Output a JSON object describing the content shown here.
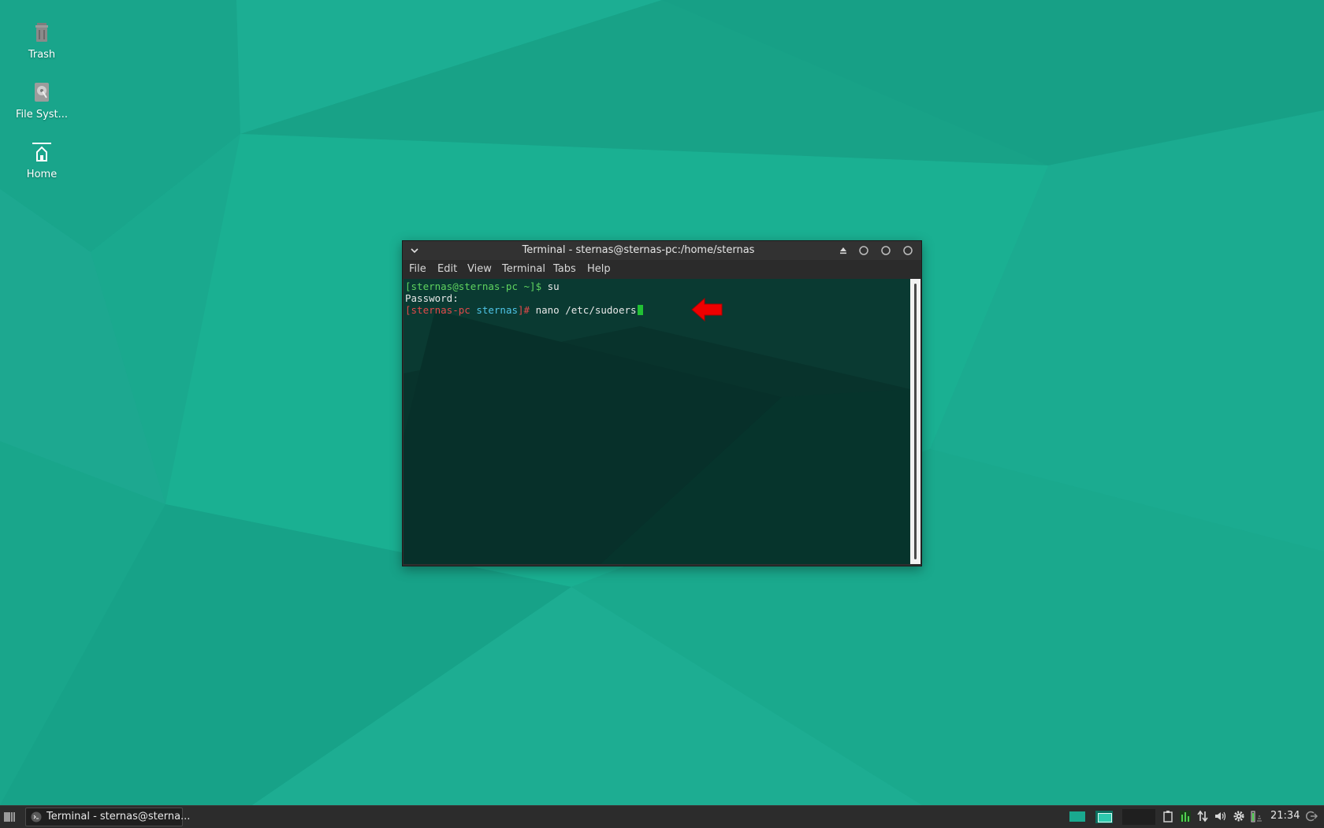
{
  "desktop": {
    "icons": [
      {
        "label": "Trash",
        "icon": "trash-icon"
      },
      {
        "label": "File Syst...",
        "icon": "file-system-icon"
      },
      {
        "label": "Home",
        "icon": "home-icon"
      }
    ],
    "wallpaper_color": "#1aa98f"
  },
  "window": {
    "title": "Terminal - sternas@sternas-pc:/home/sternas",
    "menu": [
      "File",
      "Edit",
      "View",
      "Terminal",
      "Tabs",
      "Help"
    ]
  },
  "terminal": {
    "line1": {
      "prompt": "[sternas@sternas-pc ~]$",
      "command": " su"
    },
    "line2": {
      "text": "Password:"
    },
    "line3": {
      "prompt_host": "[sternas-pc",
      "prompt_dir": "sternas",
      "prompt_end": "]#",
      "command": " nano /etc/sudoers"
    }
  },
  "taskbar": {
    "task_label": "Terminal - sternas@sterna...",
    "clock": "21:34",
    "tray_icons": [
      "clipboard-icon",
      "cpu-graph-icon",
      "network-icon",
      "volume-icon",
      "settings-icon",
      "battery-icon",
      "logout-icon"
    ]
  },
  "colors": {
    "terminal_bg": "#08332c",
    "prompt_green": "#5fd35f",
    "prompt_red": "#e24a4a",
    "prompt_cyan": "#4fc5e8",
    "annotation_arrow": "#ee0000"
  }
}
